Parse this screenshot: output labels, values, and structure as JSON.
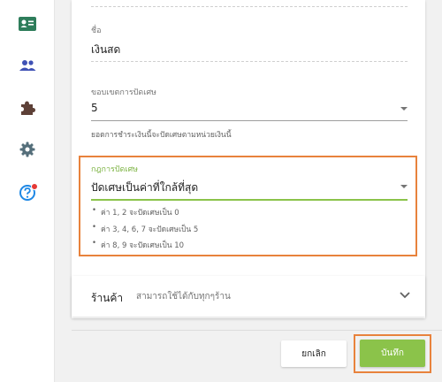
{
  "sidebar": {
    "icons": [
      {
        "name": "contact-card-icon",
        "color": "#2e7d5b"
      },
      {
        "name": "people-icon",
        "color": "#3f51b5"
      },
      {
        "name": "puzzle-icon",
        "color": "#5d4037"
      },
      {
        "name": "gear-icon",
        "color": "#546e7a"
      },
      {
        "name": "help-icon",
        "color": "#1e88e5",
        "badge_color": "#e53935"
      }
    ]
  },
  "form": {
    "name_label": "ชื่อ",
    "name_value": "เงินสด",
    "rounding_range_label": "ขอบเขตการปัดเศษ",
    "rounding_range_value": "5",
    "rounding_range_helper": "ยอดการชำระเงินนี้จะปัดเศษตามหน่วยเงินนี้",
    "rounding_rule_label": "กฎการปัดเศษ",
    "rounding_rule_value": "ปัดเศษเป็นค่าที่ใกล้ที่สุด",
    "rounding_rule_examples": [
      "ค่า 1, 2 จะปัดเศษเป็น 0",
      "ค่า 3, 4, 6, 7 จะปัดเศษเป็น 5",
      "ค่า 8, 9 จะปัดเศษเป็น 10"
    ]
  },
  "store": {
    "title": "ร้านค้า",
    "subtitle": "สามารถใช้ได้กับทุกๆร้าน"
  },
  "actions": {
    "cancel_label": "ยกเลิก",
    "save_label": "บันทึก"
  },
  "colors": {
    "accent_green": "#8bc34a",
    "highlight_orange": "#e8823c"
  }
}
